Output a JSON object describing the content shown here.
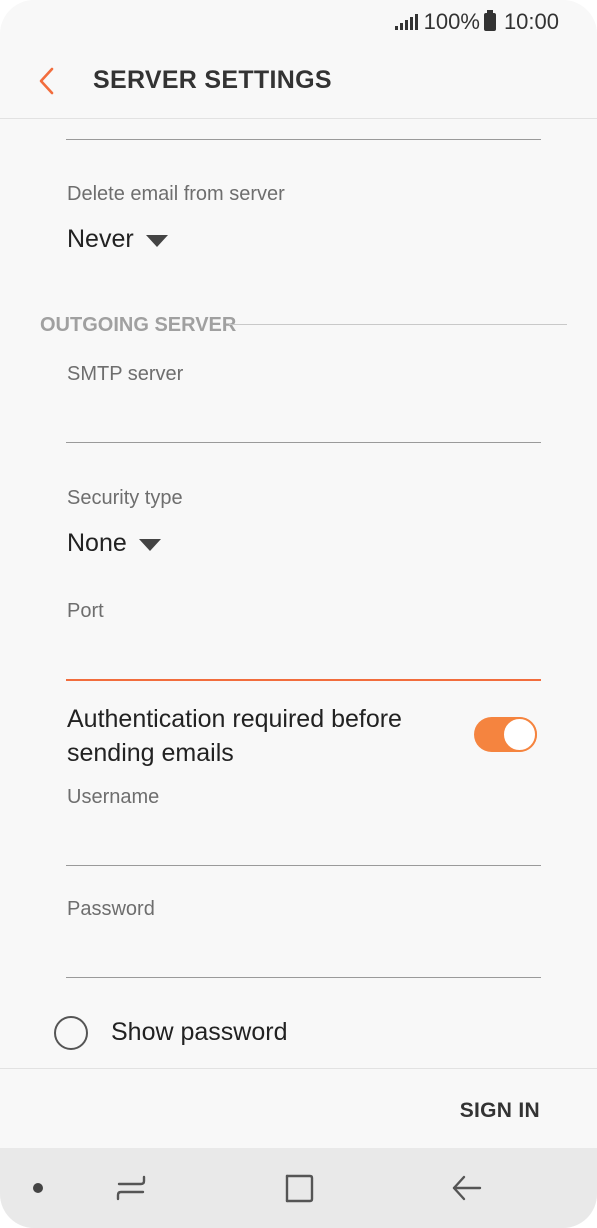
{
  "status_bar": {
    "battery": "100%",
    "time": "10:00",
    "icons": [
      "signal-icon",
      "battery-icon"
    ]
  },
  "app_bar": {
    "title": "SERVER SETTINGS",
    "back_icon": "chevron-left-icon"
  },
  "incoming": {
    "delete_email_label": "Delete email from server",
    "delete_email_value": "Never"
  },
  "outgoing": {
    "section_title": "OUTGOING SERVER",
    "smtp_label": "SMTP server",
    "smtp_value": "",
    "security_label": "Security type",
    "security_value": "None",
    "port_label": "Port",
    "port_value": "",
    "auth_label": "Authentication required before sending emails",
    "auth_enabled": true,
    "username_label": "Username",
    "username_value": "",
    "password_label": "Password",
    "password_value": "",
    "show_password_label": "Show password",
    "show_password_checked": false
  },
  "footer": {
    "sign_in_label": "SIGN IN"
  },
  "nav_bar": {
    "icons": [
      "dot-icon",
      "recents-icon",
      "home-icon",
      "back-icon"
    ]
  },
  "colors": {
    "accent": "#f26d3d",
    "toggle_on": "#f5843f",
    "background": "#f8f8f8",
    "nav_background": "#e9e9e9"
  }
}
